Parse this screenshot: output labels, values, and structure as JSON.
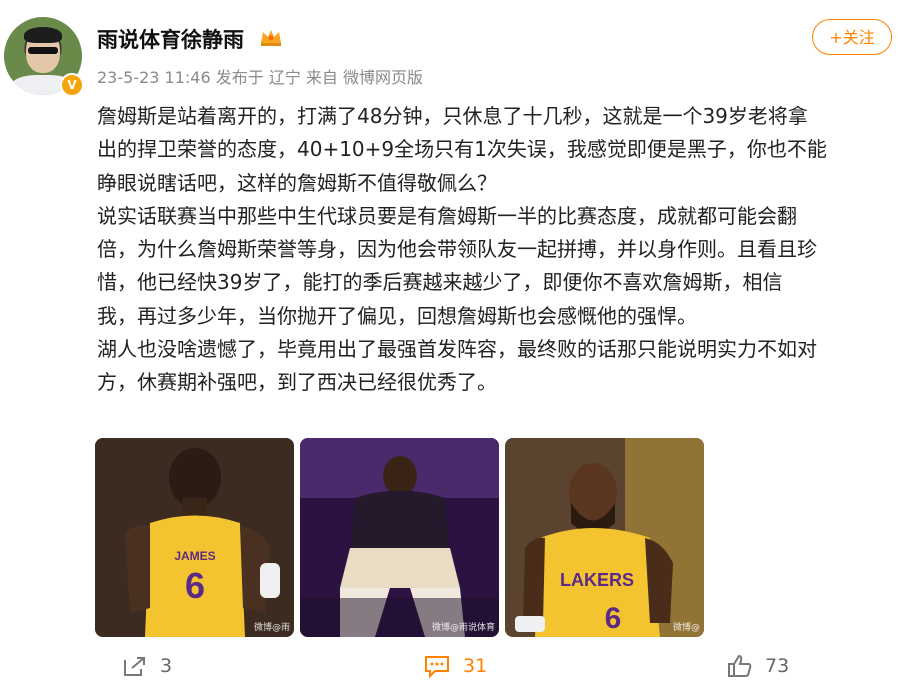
{
  "author": {
    "name": "雨说体育徐静雨",
    "verified_badge": "V"
  },
  "meta": {
    "date": "23-5-23 11:46",
    "posted_from": "发布于 辽宁",
    "source": "来自 微博网页版"
  },
  "follow_label": "+关注",
  "content_lines": [
    "詹姆斯是站着离开的，打满了48分钟，只休息了十几秒，这就是一个39岁老将拿",
    "出的捍卫荣誉的态度，40+10+9全场只有1次失误，我感觉即便是黑子，你也不能",
    "睁眼说瞎话吧，这样的詹姆斯不值得敬佩么？",
    "说实话联赛当中那些中生代球员要是有詹姆斯一半的比赛态度，成就都可能会翻",
    "倍，为什么詹姆斯荣誉等身，因为他会带领队友一起拼搏，并以身作则。且看且珍",
    "惜，他已经快39岁了，能打的季后赛越来越少了，即便你不喜欢詹姆斯，相信",
    "我，再过多少年，当你抛开了偏见，回想詹姆斯也会感慨他的强悍。",
    "湖人也没啥遗憾了，毕竟用出了最强首发阵容，最终败的话那只能说明实力不如对",
    "方，休赛期补强吧，到了西决已经很优秀了。"
  ],
  "images": [
    {
      "jersey_name": "JAMES",
      "jersey_number": "6",
      "watermark": "微博@雨"
    },
    {
      "watermark": "微博@雨说体育"
    },
    {
      "jersey_name": "LAKERS",
      "jersey_number": "6",
      "watermark": "微博@"
    }
  ],
  "actions": {
    "repost": "3",
    "comments": "31",
    "likes": "73"
  },
  "colors": {
    "accent": "#ff8200",
    "text": "#222222",
    "meta": "#8a8a8a"
  }
}
